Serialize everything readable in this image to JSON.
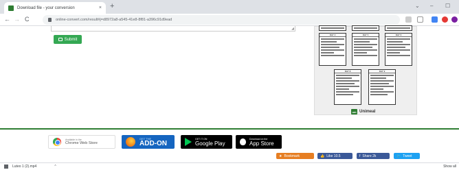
{
  "browser": {
    "tab_title": "Download file - your conversion",
    "tab_close": "×",
    "new_tab": "+",
    "url": "online-convert.com/result#j=d8972a8-a545-41e8-8f81-a396c91d9ead",
    "window_controls": [
      "⌄",
      "–",
      "☐"
    ]
  },
  "nav": {
    "back": "←",
    "forward": "→",
    "reload": "C"
  },
  "main": {
    "submit_label": "Submit"
  },
  "plan_preview": {
    "days": [
      "DAY 4",
      "DAY 5",
      "DAY 6",
      "DAY 8",
      "DAY 9"
    ],
    "brand": "Unimeal"
  },
  "footer": {
    "chrome_store_small": "Available in the",
    "chrome_store_name": "Chrome Web Store",
    "firefox_small": "GET THE",
    "firefox_big": "ADD-ON",
    "google_play_small": "GET IT ON",
    "google_play_name": "Google Play",
    "app_store_small": "Download on the",
    "app_store_name": "App Store",
    "bookmark": "Bookmark",
    "like": "Like 10.5",
    "share": "Share 2k",
    "tweet": "Tweet"
  },
  "downloads": {
    "file_name": "Luteo 1 (2).mp4",
    "show_all": "Show all"
  },
  "colors": {
    "accent_green": "#2e7d32",
    "submit_green": "#34a853",
    "facebook": "#3b5998",
    "twitter": "#1da1f2",
    "bookmark_orange": "#e67e22"
  }
}
